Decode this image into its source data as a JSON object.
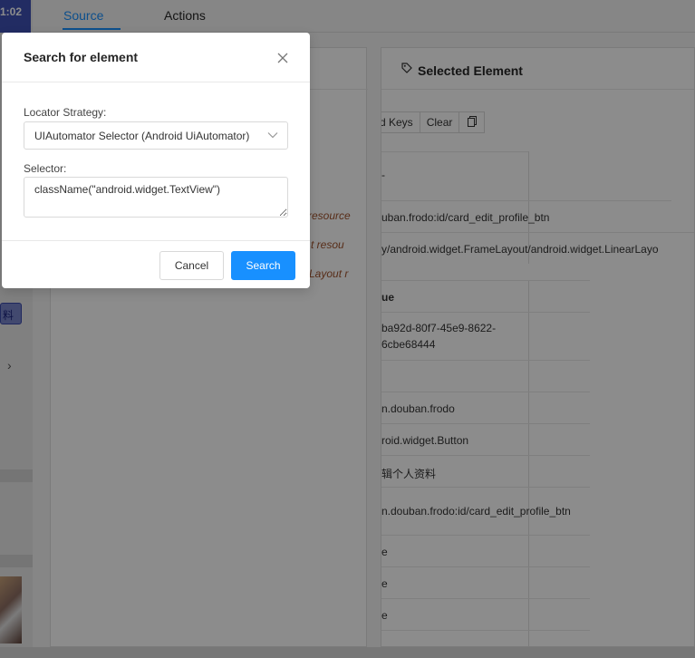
{
  "device": {
    "status_time": "1:02",
    "chip_label": "料"
  },
  "tabs": [
    {
      "label": "Source"
    },
    {
      "label": "Actions"
    }
  ],
  "source_panel": {
    "xml_fragments": [
      "resource",
      "t resou",
      "Layout r"
    ]
  },
  "selected_panel": {
    "title": "Selected Element",
    "buttons": [
      "d Keys",
      "Clear"
    ],
    "attr_rows_top": [
      {
        "text": "-"
      },
      {
        "text": "uban.frodo:id/card_edit_profile_btn"
      },
      {
        "text": "y/android.widget.FrameLayout/android.widget.LinearLayo"
      }
    ],
    "value_header": "ue",
    "attr_rows": [
      {
        "text": "ba92d-80f7-45e9-8622-"
      },
      {
        "text": "6cbe68444"
      },
      {
        "text": ""
      },
      {
        "text": "n.douban.frodo"
      },
      {
        "text": "roid.widget.Button"
      },
      {
        "text": "辑个人资料"
      },
      {
        "text": "n.douban.frodo:id/card_edit_profile_btn"
      },
      {
        "text": "e"
      },
      {
        "text": "e"
      },
      {
        "text": "e"
      },
      {
        "text": ""
      }
    ]
  },
  "modal": {
    "title": "Search for element",
    "locator_label": "Locator Strategy:",
    "locator_value": "UIAutomator Selector (Android UiAutomator)",
    "selector_label": "Selector:",
    "selector_value": "className(\"android.widget.TextView\")",
    "cancel_label": "Cancel",
    "search_label": "Search"
  }
}
